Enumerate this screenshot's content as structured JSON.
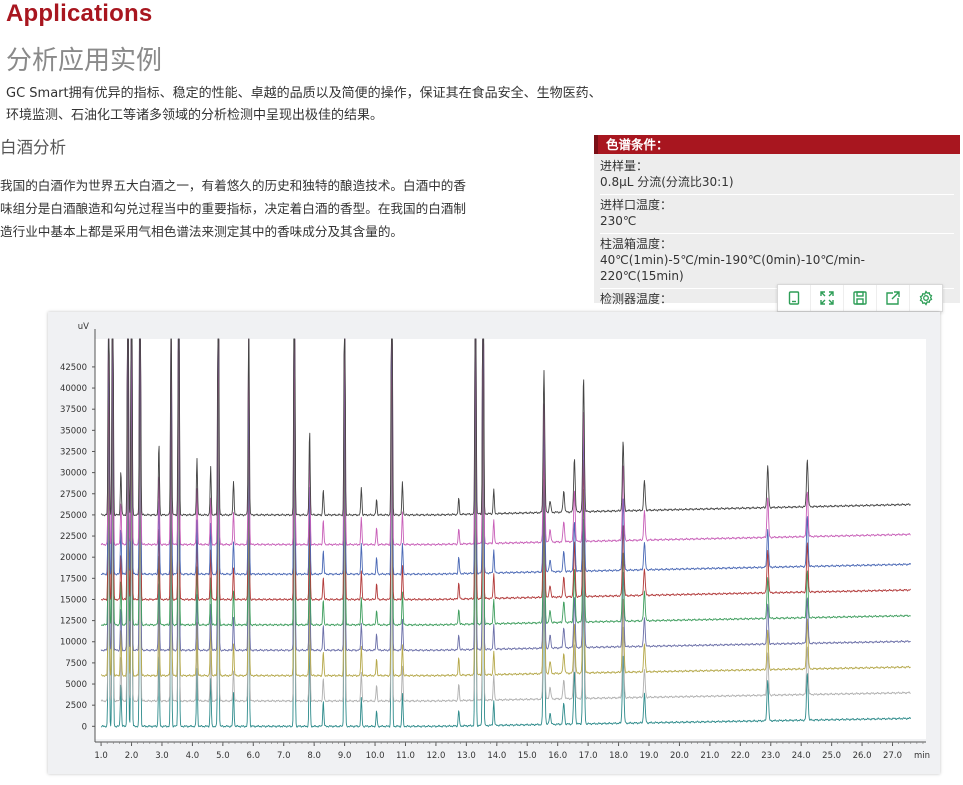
{
  "header": {
    "title_en": "Applications",
    "title_cn": "分析应用实例",
    "intro_line1": "GC Smart拥有优异的指标、稳定的性能、卓越的品质以及简便的操作，保证其在食品安全、生物医药、",
    "intro_line2": "环境监测、石油化工等诸多领域的分析检测中呈现出极佳的结果。"
  },
  "section": {
    "title": "白酒分析",
    "para_line1": "我国的白酒作为世界五大白酒之一，有着悠久的历史和独特的酿造技术。白酒中的香",
    "para_line2": "味组分是白酒酿造和勾兑过程当中的重要指标，决定着白酒的香型。在我国的白酒制",
    "para_line3": "造行业中基本上都是采用气相色谱法来测定其中的香味成分及其含量的。"
  },
  "conditions": {
    "title": "色谱条件：",
    "items": [
      {
        "label": "进样量：",
        "value": "0.8μL  分流(分流比30:1)"
      },
      {
        "label": "进样口温度：",
        "value": "230℃"
      },
      {
        "label": "柱温箱温度：",
        "value": "40℃(1min)-5℃/min-190℃(0min)-10℃/min-",
        "value2": "220℃(15min)"
      },
      {
        "label": "检测器温度：",
        "value": ""
      }
    ]
  },
  "toolbar": {
    "icons": [
      "copy-icon",
      "expand-icon",
      "save-icon",
      "share-icon",
      "settings-icon"
    ],
    "color": "#2e9e57"
  },
  "chart_data": {
    "type": "line",
    "title": "",
    "xlabel": "min",
    "ylabel": "uV",
    "xlim": [
      0.8,
      28.1
    ],
    "ylim": [
      -1500,
      45800
    ],
    "xticks": [
      1.0,
      2.0,
      3.0,
      4.0,
      5.0,
      6.0,
      7.0,
      8.0,
      9.0,
      10.0,
      11.0,
      12.0,
      13.0,
      14.0,
      15.0,
      16.0,
      17.0,
      18.0,
      19.0,
      20.0,
      21.0,
      22.0,
      23.0,
      24.0,
      25.0,
      26.0,
      27.0
    ],
    "xtick_labels": [
      "1.0",
      "2.0",
      "3.0",
      "4.0",
      "5.0",
      "6.0",
      "7.0",
      "8.0",
      "9.0",
      "10.0",
      "11.0",
      "12.0",
      "13.0",
      "14.0",
      "15.0",
      "16.0",
      "17.0",
      "18.0",
      "19.0",
      "20.0",
      "21.0",
      "22.0",
      "23.0",
      "24.0",
      "25.0",
      "26.0",
      "27.0"
    ],
    "x_unit_label": "min",
    "yticks": [
      0,
      2500,
      5000,
      7500,
      10000,
      12500,
      15000,
      17500,
      20000,
      22500,
      25000,
      27500,
      30000,
      32500,
      35000,
      37500,
      40000,
      42500
    ],
    "ytick_labels": [
      "0",
      "2500",
      "5000",
      "7500",
      "10000",
      "12500",
      "15000",
      "17500",
      "20000",
      "22500",
      "25000",
      "27500",
      "30000",
      "32500",
      "35000",
      "37500",
      "40000",
      "42500"
    ],
    "series": [
      {
        "color": "#2e8b8b",
        "baseline": 0
      },
      {
        "color": "#b0b0b0",
        "baseline": 3000
      },
      {
        "color": "#b5a84a",
        "baseline": 6000
      },
      {
        "color": "#6b6fa8",
        "baseline": 9000
      },
      {
        "color": "#3f9e5e",
        "baseline": 12000
      },
      {
        "color": "#b23a3a",
        "baseline": 15000
      },
      {
        "color": "#4a68b5",
        "baseline": 18000
      },
      {
        "color": "#c85fb8",
        "baseline": 21500
      },
      {
        "color": "#444444",
        "baseline": 25000
      }
    ],
    "peaks": [
      {
        "t": 1.25,
        "h": 36000
      },
      {
        "t": 1.38,
        "h": 46000
      },
      {
        "t": 1.65,
        "h": 5500
      },
      {
        "t": 1.88,
        "h": 46000
      },
      {
        "t": 2.0,
        "h": 46000
      },
      {
        "t": 2.28,
        "h": 46000
      },
      {
        "t": 2.9,
        "h": 9000
      },
      {
        "t": 3.3,
        "h": 28000
      },
      {
        "t": 3.55,
        "h": 46000
      },
      {
        "t": 4.15,
        "h": 7000
      },
      {
        "t": 4.6,
        "h": 6000
      },
      {
        "t": 4.85,
        "h": 46000
      },
      {
        "t": 5.35,
        "h": 4000
      },
      {
        "t": 5.85,
        "h": 27000
      },
      {
        "t": 7.35,
        "h": 46000
      },
      {
        "t": 7.85,
        "h": 11000
      },
      {
        "t": 8.3,
        "h": 3000
      },
      {
        "t": 9.0,
        "h": 37000
      },
      {
        "t": 9.55,
        "h": 3500
      },
      {
        "t": 10.05,
        "h": 2000
      },
      {
        "t": 10.55,
        "h": 46000
      },
      {
        "t": 10.9,
        "h": 4000
      },
      {
        "t": 12.75,
        "h": 2000
      },
      {
        "t": 13.3,
        "h": 46000
      },
      {
        "t": 13.55,
        "h": 46000
      },
      {
        "t": 13.9,
        "h": 3000
      },
      {
        "t": 15.55,
        "h": 18000
      },
      {
        "t": 15.75,
        "h": 1500
      },
      {
        "t": 16.2,
        "h": 2500
      },
      {
        "t": 16.55,
        "h": 6500
      },
      {
        "t": 16.85,
        "h": 17000
      },
      {
        "t": 18.15,
        "h": 9000
      },
      {
        "t": 18.85,
        "h": 3500
      },
      {
        "t": 22.9,
        "h": 5000
      },
      {
        "t": 24.2,
        "h": 6000
      }
    ]
  }
}
